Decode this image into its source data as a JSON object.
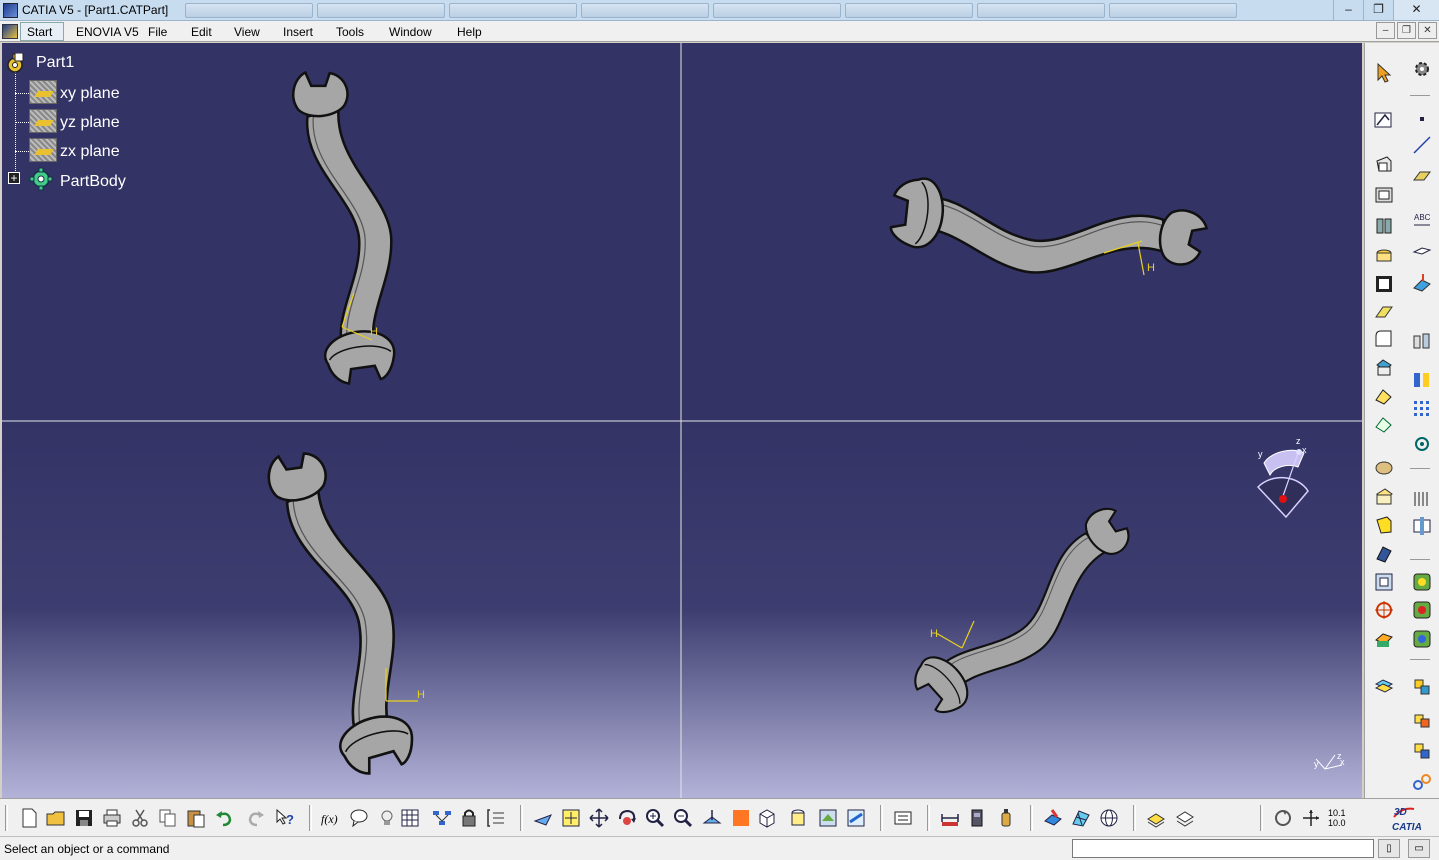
{
  "window": {
    "title": "CATIA V5 - [Part1.CATPart]",
    "minimize_label": "–",
    "maximize_label": "❐",
    "close_label": "✕"
  },
  "menubar": {
    "items": [
      "Start",
      "ENOVIA V5",
      "File",
      "Edit",
      "View",
      "Insert",
      "Tools",
      "Window",
      "Help"
    ],
    "doc_minimize_label": "–",
    "doc_restore_label": "❐",
    "doc_close_label": "✕"
  },
  "tree": {
    "root": "Part1",
    "children": [
      "xy plane",
      "yz plane",
      "zx plane",
      "PartBody"
    ]
  },
  "viewport": {
    "background_color": "#333366",
    "gradient_bottom_color": "#b3b3d9",
    "grid_line_color": "#e6e6e6",
    "part_color": "#a6a6a6",
    "axis_color": "#e8d020",
    "axis_label_h": "H",
    "axis_label_v": "V",
    "compass_labels": {
      "x": "x",
      "y": "y",
      "z": "z"
    },
    "triad_labels": {
      "x": "x",
      "y": "y",
      "z": "z"
    }
  },
  "bottom_toolbar": {
    "zoom_text_top": "10.1",
    "zoom_text_bottom": "10.0",
    "logo_text": "CATIA",
    "formula_label": "f(x)"
  },
  "status": {
    "message": "Select an object or a command",
    "command_input_value": ""
  }
}
